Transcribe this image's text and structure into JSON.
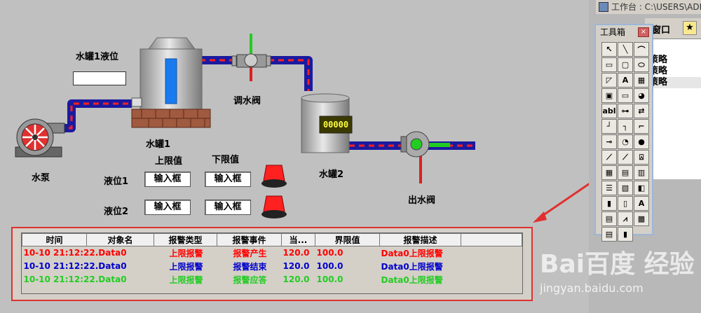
{
  "scada": {
    "tank1_level_label": "水罐1液位",
    "pump_label": "水泵",
    "tank1_label": "水罐1",
    "tank2_label": "水罐2",
    "control_valve_label": "调水阀",
    "outlet_valve_label": "出水阀",
    "tank2_display": "00000",
    "upper_limit_header": "上限值",
    "lower_limit_header": "下限值",
    "level1_label": "液位1",
    "level2_label": "液位2",
    "input_box_text": "输入框"
  },
  "alarm_table": {
    "columns": [
      "时间",
      "对象名",
      "报警类型",
      "报警事件",
      "当...",
      "界限值",
      "报警描述"
    ],
    "rows": [
      {
        "time": "10-10 21:12:22.Data0",
        "type": "上限报警",
        "event": "报警产生",
        "current": "120.0",
        "limit": "100.0",
        "desc": "Data0上限报警",
        "color": "#ff0000"
      },
      {
        "time": "10-10 21:12:22.Data0",
        "type": "上限报警",
        "event": "报警结束",
        "current": "120.0",
        "limit": "100.0",
        "desc": "Data0上限报警",
        "color": "#0000cc"
      },
      {
        "time": "10-10 21:12:22.Data0",
        "type": "上限报警",
        "event": "报警应答",
        "current": "120.0",
        "limit": "100.0",
        "desc": "Data0上限报警",
        "color": "#22cc22"
      }
    ]
  },
  "workbench": {
    "title": "工作台 : C:\\USERS\\ADM",
    "tab_label": "窗口",
    "tree_items": [
      "策略",
      "策略",
      "策略"
    ]
  },
  "toolbox": {
    "title": "工具箱",
    "close": "×",
    "tools": [
      {
        "name": "pointer-tool-icon",
        "glyph": "↖"
      },
      {
        "name": "line-tool-icon",
        "glyph": "╲"
      },
      {
        "name": "arc-tool-icon",
        "glyph": "⌒"
      },
      {
        "name": "rectangle-tool-icon",
        "glyph": "▭"
      },
      {
        "name": "rounded-rect-tool-icon",
        "glyph": "▢"
      },
      {
        "name": "ellipse-tool-icon",
        "glyph": "⬭"
      },
      {
        "name": "polygon-tool-icon",
        "glyph": "◸"
      },
      {
        "name": "text-tool-icon",
        "glyph": "A"
      },
      {
        "name": "picture-tool-icon",
        "glyph": "▦"
      },
      {
        "name": "bitmap-tool-icon",
        "glyph": "▣"
      },
      {
        "name": "frame-tool-icon",
        "glyph": "▭"
      },
      {
        "name": "globe-tool-icon",
        "glyph": "◕"
      },
      {
        "name": "input-box-tool-icon",
        "glyph": "abl"
      },
      {
        "name": "slider-tool-icon",
        "glyph": "⊶"
      },
      {
        "name": "flow-tool-icon",
        "glyph": "⇄"
      },
      {
        "name": "corner-tool-icon",
        "glyph": "┘"
      },
      {
        "name": "step-line-tool-icon",
        "glyph": "┐"
      },
      {
        "name": "curve-tool-icon",
        "glyph": "⌐"
      },
      {
        "name": "valve-tool-icon",
        "glyph": "⊸"
      },
      {
        "name": "gauge-tool-icon",
        "glyph": "◔"
      },
      {
        "name": "indicator-tool-icon",
        "glyph": "●"
      },
      {
        "name": "trend-tool-icon",
        "glyph": "⟋"
      },
      {
        "name": "history-trend-tool-icon",
        "glyph": "⟋"
      },
      {
        "name": "alarm-tool-icon",
        "glyph": "⍓"
      },
      {
        "name": "table-tool-icon",
        "glyph": "▦"
      },
      {
        "name": "report-tool-icon",
        "glyph": "▤"
      },
      {
        "name": "database-tool-icon",
        "glyph": "▥"
      },
      {
        "name": "list-tool-icon",
        "glyph": "☰"
      },
      {
        "name": "storage-tool-icon",
        "glyph": "▧"
      },
      {
        "name": "button-tool-icon",
        "glyph": "◧"
      },
      {
        "name": "bar-chart-tool-icon",
        "glyph": "▮"
      },
      {
        "name": "chart-tool-icon",
        "glyph": "▯"
      },
      {
        "name": "file-tool-icon",
        "glyph": "A"
      },
      {
        "name": "graph-tool-icon",
        "glyph": "▤"
      },
      {
        "name": "line-chart-tool-icon",
        "glyph": "⩘"
      },
      {
        "name": "grid-tool-icon",
        "glyph": "▩"
      },
      {
        "name": "data-tool-icon",
        "glyph": "▤"
      },
      {
        "name": "histogram-tool-icon",
        "glyph": "▮"
      }
    ]
  },
  "watermark": {
    "brand": "Bai百度 经验",
    "url": "jingyan.baidu.com"
  }
}
